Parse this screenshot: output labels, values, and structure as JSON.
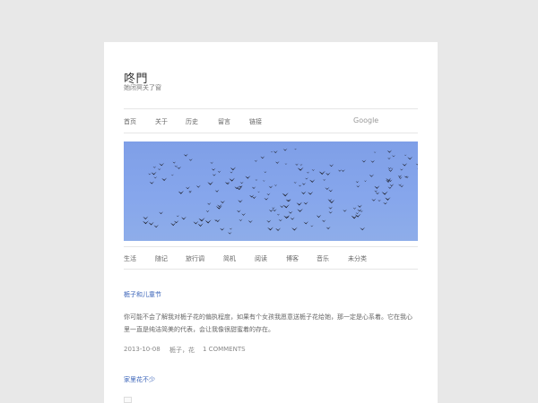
{
  "site": {
    "title": "咚門",
    "description": "她闭冥关了窗"
  },
  "nav": {
    "items": [
      "首页",
      "关于",
      "历史",
      "留言",
      "链接"
    ],
    "search_label": "Google"
  },
  "categories": [
    "生活",
    "随记",
    "旅行调",
    "简机",
    "阅读",
    "博客",
    "音乐",
    "未分类"
  ],
  "posts": [
    {
      "title": "栀子和儿童节",
      "excerpt": "你可能不会了解我对栀子花的偏执程度，如果有个女孩我愿意送栀子花给她，那一定是心系着。它在我心里一直是纯洁简美的代表，会让我像很甜蜜着的存在。",
      "date": "2013-10-08",
      "tags": "栀子，花",
      "comments": "1 COMMENTS"
    },
    {
      "title": "家里花不少"
    }
  ],
  "colors": {
    "background": "#e8e8e8",
    "page": "#ffffff",
    "link": "#3a63b8",
    "sky": "#86a6ec"
  }
}
